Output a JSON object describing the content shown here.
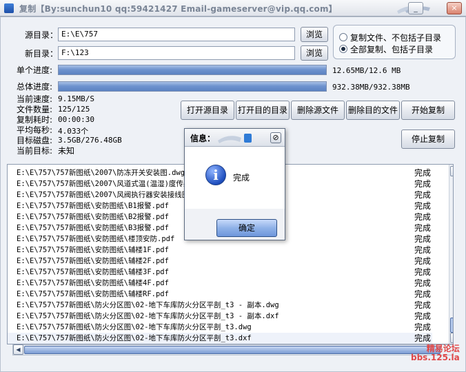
{
  "window": {
    "title": "复制【By:sunchun10 qq:59421427 Email-gameserver@vip.qq.com】",
    "controls": {
      "minimize": "_",
      "close": "×"
    }
  },
  "source": {
    "label": "源目录：",
    "value": "E:\\E\\757",
    "browse": "浏览"
  },
  "target": {
    "label": "新目录：",
    "value": "F:\\123",
    "browse": "浏览"
  },
  "options": {
    "items": [
      {
        "label": "复制文件、不包括子目录",
        "selected": false
      },
      {
        "label": "全部复制、包括子目录",
        "selected": true
      }
    ]
  },
  "progress": {
    "single": {
      "label": "单个进度:",
      "text": "12.65MB/12.6 MB",
      "fraction": 1.0
    },
    "total": {
      "label": "总体进度:",
      "text": "932.38MB/932.38MB",
      "fraction": 1.0
    }
  },
  "stats": {
    "speed": {
      "label": "当前速度:",
      "value": "9.15MB/S"
    },
    "count": {
      "label": "文件数量:",
      "value": "125/125"
    },
    "elapsed": {
      "label": "复制耗时:",
      "value": "00:00:30"
    },
    "per_second": {
      "label": "平均每秒:",
      "value": "4.033个"
    },
    "disk": {
      "label": "目标磁盘:",
      "value": "3.5GB/276.48GB"
    },
    "current": {
      "label": "当前目标:",
      "value": "未知"
    }
  },
  "buttons": {
    "open_source": "打开源目录",
    "open_target": "打开目的目录",
    "delete_source": "删除源文件",
    "delete_target": "删除目的文件",
    "start": "开始复制",
    "stop": "停止复制"
  },
  "log": [
    {
      "path": "E:\\E\\757\\757新图纸\\2007\\防冻开关安装图.dwg",
      "status": "完成"
    },
    {
      "path": "E:\\E\\757\\757新图纸\\2007\\风道式温(温湿)度传感器安装图.dwg",
      "status": "完成"
    },
    {
      "path": "E:\\E\\757\\757新图纸\\2007\\风阀执行器安装接线图.dwg",
      "status": "完成"
    },
    {
      "path": "E:\\E\\757\\757新图纸\\安防图纸\\B1报警.pdf",
      "status": "完成"
    },
    {
      "path": "E:\\E\\757\\757新图纸\\安防图纸\\B2报警.pdf",
      "status": "完成"
    },
    {
      "path": "E:\\E\\757\\757新图纸\\安防图纸\\B3报警.pdf",
      "status": "完成"
    },
    {
      "path": "E:\\E\\757\\757新图纸\\安防图纸\\楼顶安防.pdf",
      "status": "完成"
    },
    {
      "path": "E:\\E\\757\\757新图纸\\安防图纸\\辅楼1F.pdf",
      "status": "完成"
    },
    {
      "path": "E:\\E\\757\\757新图纸\\安防图纸\\辅楼2F.pdf",
      "status": "完成"
    },
    {
      "path": "E:\\E\\757\\757新图纸\\安防图纸\\辅楼3F.pdf",
      "status": "完成"
    },
    {
      "path": "E:\\E\\757\\757新图纸\\安防图纸\\辅楼4F.pdf",
      "status": "完成"
    },
    {
      "path": "E:\\E\\757\\757新图纸\\安防图纸\\辅楼RF.pdf",
      "status": "完成"
    },
    {
      "path": "E:\\E\\757\\757新图纸\\防火分区图\\02-地下车库防火分区平剖_t3 - 副本.dwg",
      "status": "完成"
    },
    {
      "path": "E:\\E\\757\\757新图纸\\防火分区图\\02-地下车库防火分区平剖_t3 - 副本.dxf",
      "status": "完成"
    },
    {
      "path": "E:\\E\\757\\757新图纸\\防火分区图\\02-地下车库防火分区平剖_t3.dwg",
      "status": "完成"
    },
    {
      "path": "E:\\E\\757\\757新图纸\\防火分区图\\02-地下车库防火分区平剖_t3.dxf",
      "status": "完成"
    }
  ],
  "dialog": {
    "title": "信息：",
    "message": "完成",
    "ok": "确定",
    "close_icon": "⊘"
  },
  "watermark": {
    "line1": "精易论坛",
    "line2": "bbs.125.la"
  },
  "colors": {
    "progress_fill": "#6f93cf",
    "accent": "#4e6da4"
  }
}
